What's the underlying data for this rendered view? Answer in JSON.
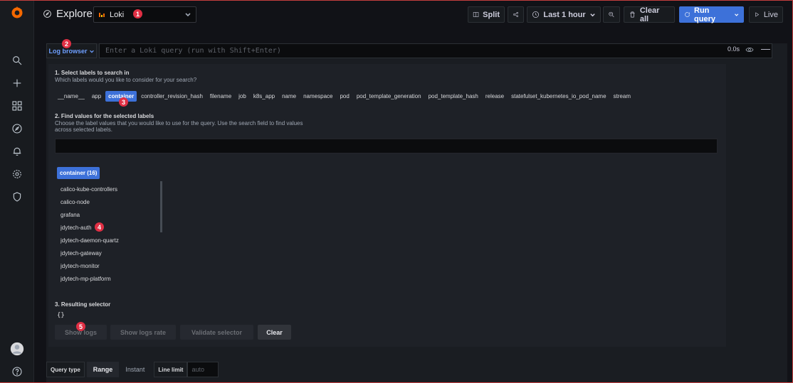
{
  "topbar": {
    "title": "Explore",
    "datasource": "Loki",
    "split_label": "Split",
    "time_range": "Last 1 hour",
    "clear_all_label": "Clear all",
    "run_query_label": "Run query",
    "live_label": "Live"
  },
  "query": {
    "log_browser_label": "Log browser",
    "placeholder": "Enter a Loki query (run with Shift+Enter)",
    "duration": "0.0s"
  },
  "browser": {
    "step1_title": "1. Select labels to search in",
    "step1_desc": "Which labels would you like to consider for your search?",
    "labels": [
      "__name__",
      "app",
      "container",
      "controller_revision_hash",
      "filename",
      "job",
      "k8s_app",
      "name",
      "namespace",
      "pod",
      "pod_template_generation",
      "pod_template_hash",
      "release",
      "statefulset_kubernetes_io_pod_name",
      "stream"
    ],
    "selected_label": "container",
    "step2_title": "2. Find values for the selected labels",
    "step2_desc": "Choose the label values that you would like to use for the query. Use the search field to find values across selected labels.",
    "values_header": "container (16)",
    "values": [
      "calico-kube-controllers",
      "calico-node",
      "grafana",
      "jdytech-auth",
      "jdytech-daemon-quartz",
      "jdytech-gateway",
      "jdytech-monitor",
      "jdytech-mp-platform"
    ],
    "step3_title": "3. Resulting selector",
    "selector": "{}",
    "show_logs": "Show logs",
    "show_logs_rate": "Show logs rate",
    "validate_selector": "Validate selector",
    "clear": "Clear"
  },
  "options": {
    "query_type_label": "Query type",
    "range": "Range",
    "instant": "Instant",
    "line_limit_label": "Line limit",
    "line_limit_placeholder": "auto"
  },
  "badges": [
    "1",
    "2",
    "3",
    "4",
    "5"
  ],
  "colors": {
    "accent": "#3d71d9",
    "badge": "#e02f44",
    "logo": "#f46800"
  }
}
